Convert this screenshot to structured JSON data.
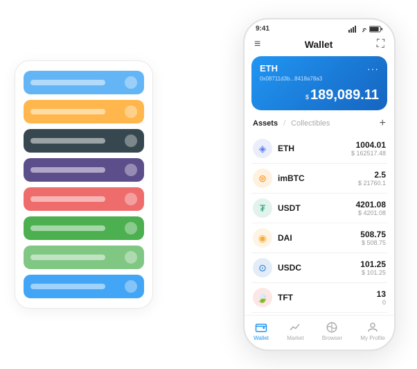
{
  "app": {
    "title": "Wallet"
  },
  "status_bar": {
    "time": "9:41"
  },
  "eth_card": {
    "label": "ETH",
    "address": "0x08711d3b...8418a78a3",
    "dots": "···",
    "balance_label": "$",
    "balance": "189,089.11"
  },
  "assets_section": {
    "tab_active": "Assets",
    "tab_divider": "/",
    "tab_inactive": "Collectibles",
    "add_icon": "+"
  },
  "assets": [
    {
      "name": "ETH",
      "icon_color": "#627EEA",
      "icon_symbol": "◈",
      "amount": "1004.01",
      "usd": "$ 162517.48"
    },
    {
      "name": "imBTC",
      "icon_color": "#F7931A",
      "icon_symbol": "⊛",
      "amount": "2.5",
      "usd": "$ 21760.1"
    },
    {
      "name": "USDT",
      "icon_color": "#26A17B",
      "icon_symbol": "₮",
      "amount": "4201.08",
      "usd": "$ 4201.08"
    },
    {
      "name": "DAI",
      "icon_color": "#F5AC37",
      "icon_symbol": "◉",
      "amount": "508.75",
      "usd": "$ 508.75"
    },
    {
      "name": "USDC",
      "icon_color": "#2775CA",
      "icon_symbol": "⊙",
      "amount": "101.25",
      "usd": "$ 101.25"
    },
    {
      "name": "TFT",
      "icon_color": "#E84142",
      "icon_symbol": "🍃",
      "amount": "13",
      "usd": "0"
    }
  ],
  "bottom_nav": [
    {
      "label": "Wallet",
      "active": true,
      "icon": "wallet"
    },
    {
      "label": "Market",
      "active": false,
      "icon": "market"
    },
    {
      "label": "Browser",
      "active": false,
      "icon": "browser"
    },
    {
      "label": "My Profile",
      "active": false,
      "icon": "profile"
    }
  ],
  "card_stack": [
    {
      "color": "#64B5F6"
    },
    {
      "color": "#FFB74D"
    },
    {
      "color": "#37474F"
    },
    {
      "color": "#5C4E8A"
    },
    {
      "color": "#EF6C6C"
    },
    {
      "color": "#4CAF50"
    },
    {
      "color": "#81C784"
    },
    {
      "color": "#42A5F5"
    }
  ]
}
